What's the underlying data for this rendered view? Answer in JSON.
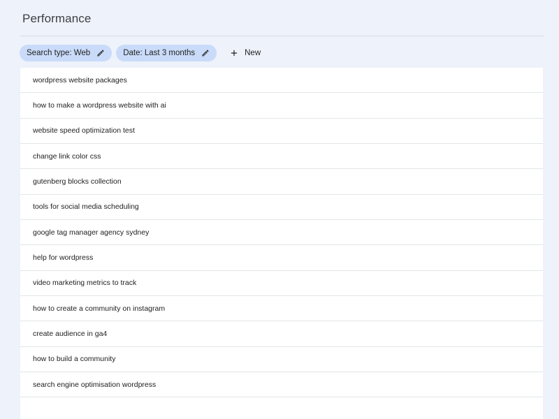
{
  "page": {
    "title": "Performance"
  },
  "filters": {
    "chips": [
      {
        "label": "Search type: Web",
        "icon": "pencil-icon"
      },
      {
        "label": "Date: Last 3 months",
        "icon": "pencil-icon"
      }
    ],
    "new_label": "New",
    "new_icon": "plus-icon"
  },
  "queries": [
    "wordpress website packages",
    "how to make a wordpress website with ai",
    "website speed optimization test",
    "change link color css",
    "gutenberg blocks collection",
    "tools for social media scheduling",
    "google tag manager agency sydney",
    "help for wordpress",
    "video marketing metrics to track",
    "how to create a community on instagram",
    "create audience in ga4",
    "how to build a community",
    "search engine optimisation wordpress",
    ""
  ],
  "colors": {
    "background": "#eef2fa",
    "chip": "#c9dbf9",
    "surface": "#ffffff"
  }
}
